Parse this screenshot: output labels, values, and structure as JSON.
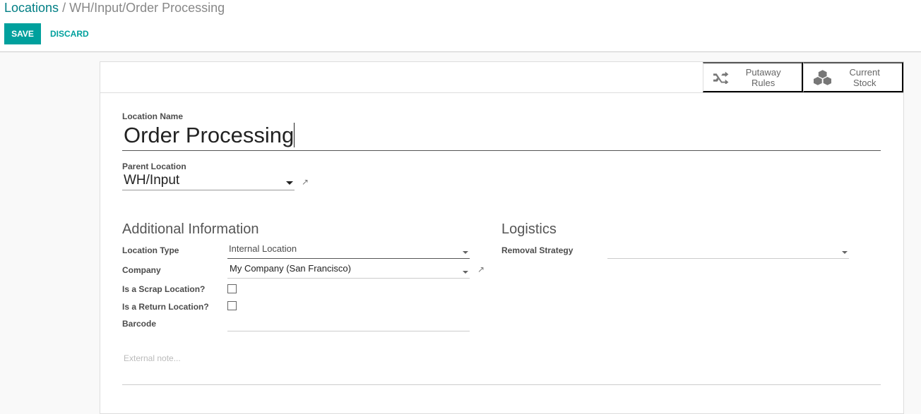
{
  "breadcrumb": {
    "parent": "Locations",
    "separator": "/",
    "current": "WH/Input/Order Processing"
  },
  "toolbar": {
    "save": "SAVE",
    "discard": "DISCARD"
  },
  "smart_buttons": [
    {
      "label": "Putaway Rules",
      "icon": "shuffle-icon"
    },
    {
      "label": "Current Stock",
      "icon": "cubes-icon"
    }
  ],
  "form": {
    "location_name_label": "Location Name",
    "location_name": "Order Processing",
    "parent_location_label": "Parent Location",
    "parent_location": "WH/Input",
    "additional_info_title": "Additional Information",
    "location_type_label": "Location Type",
    "location_type": "Internal Location",
    "company_label": "Company",
    "company": "My Company (San Francisco)",
    "scrap_label": "Is a Scrap Location?",
    "scrap": false,
    "return_label": "Is a Return Location?",
    "return": false,
    "barcode_label": "Barcode",
    "barcode": "",
    "logistics_title": "Logistics",
    "removal_strategy_label": "Removal Strategy",
    "removal_strategy": "",
    "note_placeholder": "External note..."
  },
  "colors": {
    "primary": "#00a09d",
    "link": "#017e84"
  }
}
